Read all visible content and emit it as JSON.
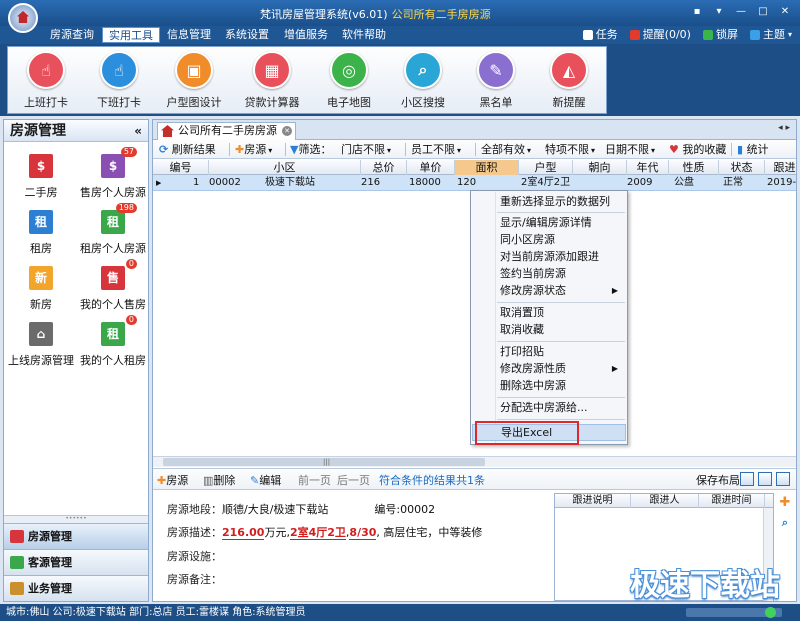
{
  "window": {
    "title": "梵讯房屋管理系统(v6.01)",
    "subtitle": "公司所有二手房房源",
    "controls": [
      "▪",
      "▾",
      "—",
      "□",
      "✕"
    ]
  },
  "menu": {
    "items": [
      "房源查询",
      "实用工具",
      "信息管理",
      "系统设置",
      "增值服务",
      "软件帮助"
    ],
    "active": "实用工具",
    "right": {
      "task": "任务",
      "remind": "提醒(0/0)",
      "lock": "锁屏",
      "theme": "主题"
    }
  },
  "ribbon": {
    "buttons": [
      {
        "label": "上班打卡",
        "color": "#e8505b",
        "glyph": "☝"
      },
      {
        "label": "下班打卡",
        "color": "#2c8fde",
        "glyph": "☝"
      },
      {
        "label": "户型图设计",
        "color": "#f08c2a",
        "glyph": "▣"
      },
      {
        "label": "贷款计算器",
        "color": "#e8505b",
        "glyph": "▦"
      },
      {
        "label": "电子地图",
        "color": "#3bb34a",
        "glyph": "◎"
      },
      {
        "label": "小区搜搜",
        "color": "#2aa6d6",
        "glyph": "⌕"
      },
      {
        "label": "黑名单",
        "color": "#8a6fd0",
        "glyph": "✎"
      },
      {
        "label": "新提醒",
        "color": "#e8505b",
        "glyph": "◭"
      }
    ]
  },
  "sidebar": {
    "title": "房源管理",
    "collapse": "«",
    "cells": [
      {
        "label": "二手房",
        "color": "#d8343c",
        "glyph": "$",
        "badge": ""
      },
      {
        "label": "售房个人房源",
        "color": "#8a4fb2",
        "glyph": "$",
        "badge": "57"
      },
      {
        "label": "租房",
        "color": "#2d7fd4",
        "glyph": "租",
        "badge": ""
      },
      {
        "label": "租房个人房源",
        "color": "#3aa84a",
        "glyph": "租",
        "badge": "198"
      },
      {
        "label": "新房",
        "color": "#f2a42b",
        "glyph": "新",
        "badge": ""
      },
      {
        "label": "我的个人售房",
        "color": "#d8343c",
        "glyph": "售",
        "badge": "0"
      },
      {
        "label": "上线房源管理",
        "color": "#6b6b6b",
        "glyph": "⌂",
        "badge": ""
      },
      {
        "label": "我的个人租房",
        "color": "#3aa84a",
        "glyph": "租",
        "badge": "0"
      }
    ],
    "nav": [
      {
        "label": "房源管理",
        "color": "#d8343c"
      },
      {
        "label": "客源管理",
        "color": "#3aa84a"
      },
      {
        "label": "业务管理",
        "color": "#c9902c"
      }
    ]
  },
  "tab": {
    "label": "公司所有二手房房源",
    "arrows": "◂ ▸"
  },
  "toolbar": {
    "refresh": "刷新结果",
    "add": "房源",
    "filter": "筛选：",
    "store": "门店不限",
    "staff": "员工不限",
    "valid": "全部有效",
    "special": "特项不限",
    "date": "日期不限",
    "fav": "我的收藏",
    "stats": "统计"
  },
  "grid": {
    "columns": [
      "编号",
      "小区",
      "总价",
      "单价",
      "面积",
      "户型",
      "朝向",
      "年代",
      "性质",
      "状态",
      "跟进"
    ],
    "row": {
      "index": "1",
      "id": "00002",
      "community": "极速下载站",
      "total": "216",
      "unit": "18000",
      "area": "120",
      "layout": "2室4厅2卫",
      "facing": "",
      "year": "2009",
      "nature": "公盘",
      "status": "正常",
      "follow": "2019-0"
    }
  },
  "context_menu": {
    "items": [
      {
        "label": "重新选择显示的数据列",
        "submenu": false
      },
      {
        "label": "显示/编辑房源详情",
        "submenu": false
      },
      {
        "label": "同小区房源",
        "submenu": false
      },
      {
        "label": "对当前房源添加跟进",
        "submenu": false
      },
      {
        "label": "签约当前房源",
        "submenu": false
      },
      {
        "label": "修改房源状态",
        "submenu": true
      },
      {
        "label": "取消置顶",
        "submenu": false
      },
      {
        "label": "取消收藏",
        "submenu": false
      },
      {
        "label": "打印招贴",
        "submenu": false
      },
      {
        "label": "修改房源性质",
        "submenu": true
      },
      {
        "label": "删除选中房源",
        "submenu": false
      },
      {
        "label": "分配选中房源给...",
        "submenu": false
      },
      {
        "label": "导出Excel",
        "submenu": false
      }
    ],
    "highlighted": "导出Excel"
  },
  "bottom_toolbar": {
    "add": "房源",
    "delete": "删除",
    "edit": "编辑",
    "prev": "前一页",
    "next": "后一页",
    "result": "符合条件的结果共1条",
    "save_layout": "保存布局"
  },
  "detail": {
    "location_label": "房源地段：",
    "location": "顺德/大良/极速下载站",
    "id_label": "编号:00002",
    "desc_label": "房源描述：",
    "price": "216.00",
    "price_unit": "万元,",
    "layout": "2室4厅2卫",
    "comma": ",",
    "floor": "8/30",
    "desc_rest": ", 高层住宅，中等装修",
    "facility_label": "房源设施：",
    "note_label": "房源备注："
  },
  "follow_panel": {
    "columns": [
      "跟进说明",
      "跟进人",
      "跟进时间"
    ]
  },
  "status": {
    "text": "城市:佛山  公司:极速下载站  部门:总店  员工:雷楼谋  角色:系统管理员"
  },
  "watermark": "极速下载站"
}
